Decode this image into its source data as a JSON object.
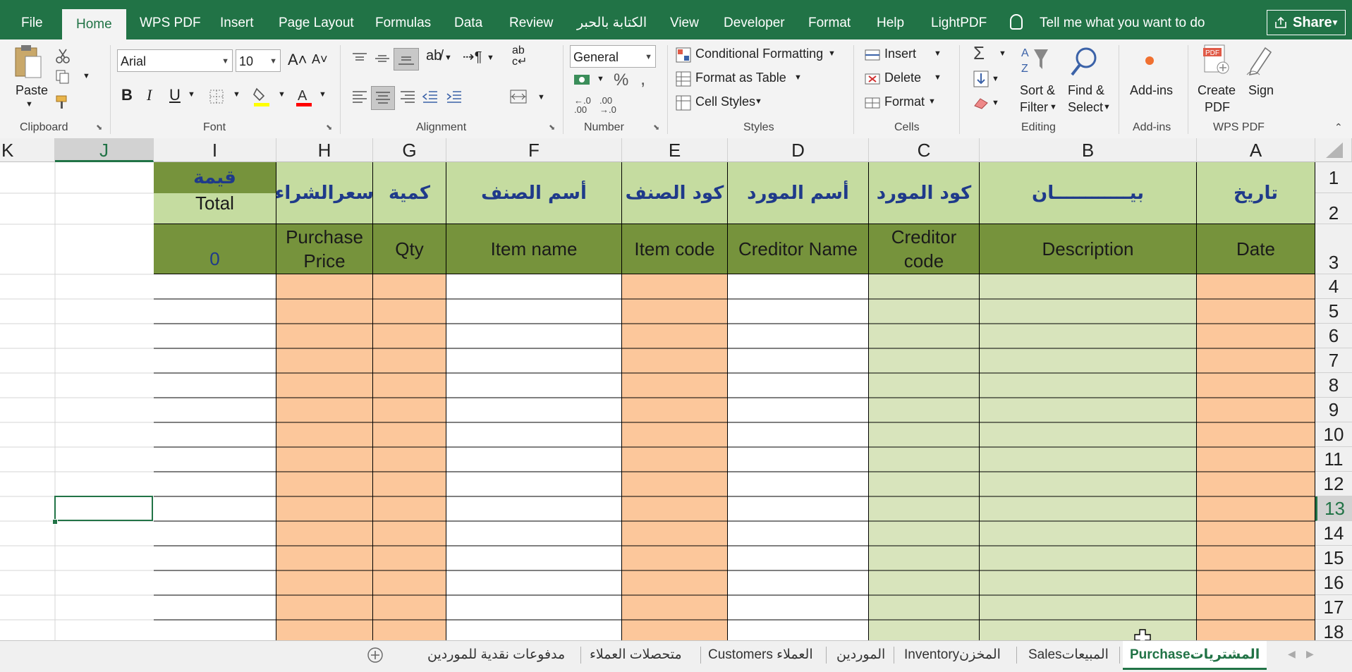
{
  "ribbon_tabs": [
    "File",
    "Home",
    "WPS PDF",
    "Insert",
    "Page Layout",
    "Formulas",
    "Data",
    "Review",
    "الكتابة بالحبر",
    "View",
    "Developer",
    "Format",
    "Help",
    "LightPDF"
  ],
  "tell_me": "Tell me what you want to do",
  "share_label": "Share",
  "clipboard": {
    "paste": "Paste",
    "group": "Clipboard"
  },
  "font": {
    "name": "Arial",
    "size": "10",
    "group": "Font"
  },
  "alignment": {
    "group": "Alignment"
  },
  "number": {
    "format": "General",
    "group": "Number"
  },
  "styles": {
    "conditional": "Conditional Formatting",
    "table": "Format as Table",
    "cell_styles": "Cell Styles",
    "group": "Styles"
  },
  "cells": {
    "insert": "Insert",
    "delete": "Delete",
    "format": "Format",
    "group": "Cells"
  },
  "editing": {
    "sort1": "Sort &",
    "sort2": "Filter",
    "find1": "Find &",
    "find2": "Select",
    "group": "Editing"
  },
  "addins": {
    "label": "Add-ins",
    "group": "Add-ins"
  },
  "wpspdf": {
    "create1": "Create",
    "create2": "PDF",
    "sign": "Sign",
    "group": "WPS PDF"
  },
  "columns": [
    "K",
    "J",
    "I",
    "H",
    "G",
    "F",
    "E",
    "D",
    "C",
    "B",
    "A"
  ],
  "rows": [
    "1",
    "2",
    "3",
    "4",
    "5",
    "6",
    "7",
    "8",
    "9",
    "10",
    "11",
    "12",
    "13",
    "14",
    "15",
    "16",
    "17",
    "18"
  ],
  "headers": {
    "I_ar": "قيمة",
    "I_total": "Total",
    "I_value": "0",
    "H_ar": "سعرالشراء",
    "H_en": "Purchase Price",
    "G_ar": "كمية",
    "G_en": "Qty",
    "F_ar": "أسم الصنف",
    "F_en": "Item name",
    "E_ar": "كود الصنف",
    "E_en": "Item code",
    "D_ar": "أسم المورد",
    "D_en": "Creditor Name",
    "C_ar": "كود المورد",
    "C_en": "Creditor code",
    "B_ar": "بيــــــــــــان",
    "B_en": "Description",
    "A_ar": "تاريخ",
    "A_en": "Date"
  },
  "sheet_tabs": [
    "مدفوعات نقدية للموردين",
    "متحصلات العملاء",
    "Customers العملاء",
    "الموردين",
    "Inventoryالمخزن",
    "Salesالمبيعات",
    "Purchaseالمشتريات"
  ],
  "active_sheet": "Purchaseالمشتريات",
  "colors": {
    "excel_green": "#217346",
    "header_green": "#c5dca0",
    "header_dark": "#76933c",
    "peach": "#fcc79b",
    "light_green": "#d8e4bc",
    "arabic_blue": "#1f3a8a"
  }
}
